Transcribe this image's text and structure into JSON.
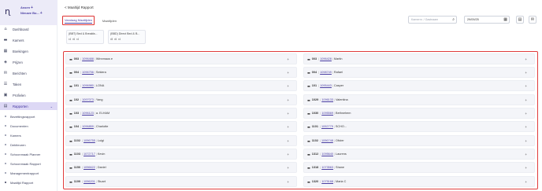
{
  "sidebar": {
    "brand1": "Assen",
    "brand2": "Nieuwe Bo...",
    "items": [
      {
        "label": "Dashboard",
        "icon": "home-icon"
      },
      {
        "label": "Kamers",
        "icon": "bed-icon"
      },
      {
        "label": "Boekingen",
        "icon": "calendar-icon"
      },
      {
        "label": "Prijzen",
        "icon": "tag-icon"
      },
      {
        "label": "Berichten",
        "icon": "message-icon"
      },
      {
        "label": "Taken",
        "icon": "list-icon"
      },
      {
        "label": "Profielen",
        "icon": "user-icon"
      },
      {
        "label": "Rapporten",
        "icon": "chart-icon"
      }
    ],
    "subitems": [
      "Bezettingsrapport",
      "Documenten",
      "Kamers",
      "Debiteuren",
      "Schoonmaak Planner",
      "Schoonmaak Rapport",
      "Managementrapport",
      "Maaltijd Rapport"
    ]
  },
  "header": {
    "back_label": "< Maaltijd Rapport",
    "tabs": [
      "Vandaag Maaltijden",
      "Maaltijden"
    ],
    "search_placeholder": "Kamernr. / Gastnaam",
    "date_value": "29/09/25"
  },
  "summaries": [
    {
      "title": "(BBT) Bed & Breakfa...",
      "counts": [
        "4",
        "6",
        "4"
      ]
    },
    {
      "title": "(BBD) Direct Bed & B...",
      "counts": [
        "8",
        "6",
        "4"
      ]
    }
  ],
  "rows_left": [
    {
      "num": "003",
      "code": "1096488",
      "name": "Winnmaus e"
    },
    {
      "num": "004",
      "code": "1096756",
      "name": "Sekiera"
    },
    {
      "num": "101",
      "code": "1096980",
      "name": "LONA"
    },
    {
      "num": "102",
      "code": "1097073",
      "name": "Yang"
    },
    {
      "num": "103",
      "code": "1096123",
      "name": "a. ELHAM"
    },
    {
      "num": "104",
      "code": "1096859",
      "name": "Charlotte"
    },
    {
      "num": "1102",
      "code": "1096755",
      "name": "Luigi"
    },
    {
      "num": "1103",
      "code": "1072717",
      "name": "Kevin"
    },
    {
      "num": "1150",
      "code": "1096622",
      "name": "Daniel"
    },
    {
      "num": "1199",
      "code": "1096201",
      "name": "Stuart"
    }
  ],
  "rows_right": [
    {
      "num": "003",
      "code": "1096428",
      "name": "Martin"
    },
    {
      "num": "004",
      "code": "1098749",
      "name": "Rafael"
    },
    {
      "num": "101",
      "code": "1095443",
      "name": "Casper"
    },
    {
      "num": "1029",
      "code": "1096133",
      "name": "Valentina"
    },
    {
      "num": "1030",
      "code": "1095569",
      "name": "Bethnehem"
    },
    {
      "num": "1101",
      "code": "1092779",
      "name": "SCHO..."
    },
    {
      "num": "1102",
      "code": "1096748",
      "name": "Olivier"
    },
    {
      "num": "1312",
      "code": "1095640",
      "name": "Laurens"
    },
    {
      "num": "1318",
      "code": "1073563",
      "name": "Shane"
    },
    {
      "num": "1320",
      "code": "1075168",
      "name": "Maria C"
    }
  ]
}
